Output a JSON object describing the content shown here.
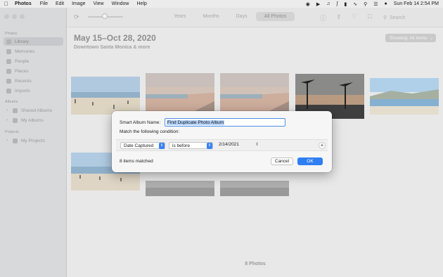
{
  "menubar": {
    "app_name": "Photos",
    "items": [
      "File",
      "Edit",
      "Image",
      "View",
      "Window",
      "Help"
    ],
    "clock": "Sun Feb 14  2:54 PM"
  },
  "sidebar": {
    "section_photos": "Photos",
    "items": [
      {
        "label": "Library",
        "icon": "library-icon"
      },
      {
        "label": "Memories",
        "icon": "memories-icon"
      },
      {
        "label": "People",
        "icon": "people-icon"
      },
      {
        "label": "Places",
        "icon": "places-icon"
      },
      {
        "label": "Recents",
        "icon": "recents-icon"
      },
      {
        "label": "Imports",
        "icon": "imports-icon"
      }
    ],
    "section_albums": "Albums",
    "albums": [
      {
        "label": "Shared Albums"
      },
      {
        "label": "My Albums"
      }
    ],
    "section_projects": "Projects",
    "projects": [
      {
        "label": "My Projects"
      }
    ]
  },
  "toolbar": {
    "tabs": [
      "Years",
      "Months",
      "Days",
      "All Photos"
    ],
    "selected_tab": "All Photos",
    "search_placeholder": "Search"
  },
  "main": {
    "title": "May 15–Oct 28, 2020",
    "subtitle": "Downtown Santa Monica & more",
    "showing_label": "Showing: All Items",
    "photo_count": "8 Photos"
  },
  "dialog": {
    "name_label": "Smart Album Name:",
    "name_value": "Find Duplicate Photo Album",
    "condition_label": "Match the following condition:",
    "field_select": "Date Captured",
    "operator_select": "is before",
    "date_value": "2/14/2021",
    "matched_text": "8 items matched",
    "cancel_label": "Cancel",
    "ok_label": "OK"
  },
  "colors": {
    "accent": "#2f7ff2",
    "sidebar_bg": "#d8d9db",
    "window_bg": "#e8e8e8"
  }
}
